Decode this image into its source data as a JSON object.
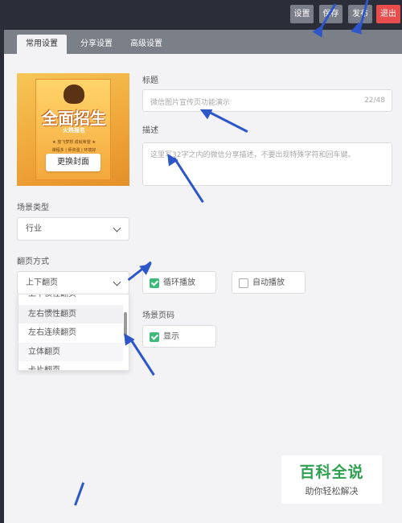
{
  "topbar": {
    "buttons": [
      {
        "label": "设置"
      },
      {
        "label": "保存"
      },
      {
        "label": "发布"
      },
      {
        "label": "退出"
      }
    ]
  },
  "tabs": [
    {
      "label": "常用设置",
      "active": true
    },
    {
      "label": "分享设置",
      "active": false
    },
    {
      "label": "高级设置",
      "active": false
    }
  ],
  "cover": {
    "poster_title": "全面招生",
    "poster_sub": "火热报名",
    "poster_line": "★ 放飞梦想 成就希望 ★",
    "poster_line2": "课程多 | 师资强 | 环境好",
    "change_label": "更换封面"
  },
  "title_field": {
    "label": "标题",
    "placeholder": "微信图片宣传页功能演示",
    "counter": "22/48"
  },
  "desc_field": {
    "label": "描述",
    "placeholder": "这里写32字之内的微信分享描述，不要出现特殊字符和回车键。"
  },
  "scene_type": {
    "label": "场景类型",
    "value": "行业"
  },
  "page_turn": {
    "label": "翻页方式",
    "value": "上下翻页",
    "options": [
      "上下惯性翻页",
      "左右惯性翻页",
      "左右连续翻页",
      "立体翻页",
      "卡片翻页"
    ]
  },
  "loop_play": {
    "label": "循环播放",
    "checked": true
  },
  "auto_play": {
    "label": "自动播放",
    "checked": false
  },
  "page_number": {
    "label": "场景页码",
    "show_label": "显示",
    "checked": true
  },
  "watermark": {
    "title": "百科全说",
    "subtitle": "助你轻松解决"
  },
  "colors": {
    "accent": "#3dba7a",
    "exit": "#e84c4c",
    "annotation": "#2d56c9"
  }
}
